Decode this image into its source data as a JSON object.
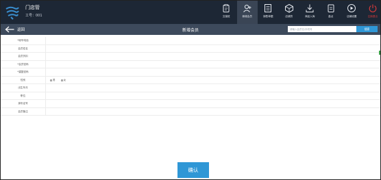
{
  "header": {
    "store_name": "门店管",
    "staff_no": "工号：001"
  },
  "toolbar": {
    "items": [
      {
        "label": "交接班",
        "icon": "clipboard-icon"
      },
      {
        "label": "新增会员",
        "icon": "user-add-icon"
      },
      {
        "label": "销售单据",
        "icon": "receipt-icon"
      },
      {
        "label": "店铺货",
        "icon": "box-icon"
      },
      {
        "label": "商品入库",
        "icon": "download-icon"
      },
      {
        "label": "盘点",
        "icon": "checklist-icon"
      },
      {
        "label": "店铺设置",
        "icon": "play-circle-icon"
      },
      {
        "label": "注销退出",
        "icon": "power-icon"
      }
    ]
  },
  "subheader": {
    "back_label": "返回",
    "title": "新增会员",
    "search_placeholder": "请输入会员名/手机号",
    "search_button": "搜索"
  },
  "form": {
    "fields": [
      {
        "label": "*帐号电话"
      },
      {
        "label": "会员姓名"
      },
      {
        "label": "会员折扣"
      },
      {
        "label": "*会员密码"
      },
      {
        "label": "*重复密码"
      },
      {
        "label": "性别"
      },
      {
        "label": "出生年月"
      },
      {
        "label": "职位"
      },
      {
        "label": "身份证号"
      },
      {
        "label": "会员备注"
      }
    ],
    "gender_options": [
      "男",
      "女"
    ]
  },
  "confirm_label": "确认",
  "colors": {
    "topbar": "#1d2735",
    "subbar": "#3d4a5c",
    "accent": "#2f97d6",
    "danger": "#e23b3b"
  }
}
